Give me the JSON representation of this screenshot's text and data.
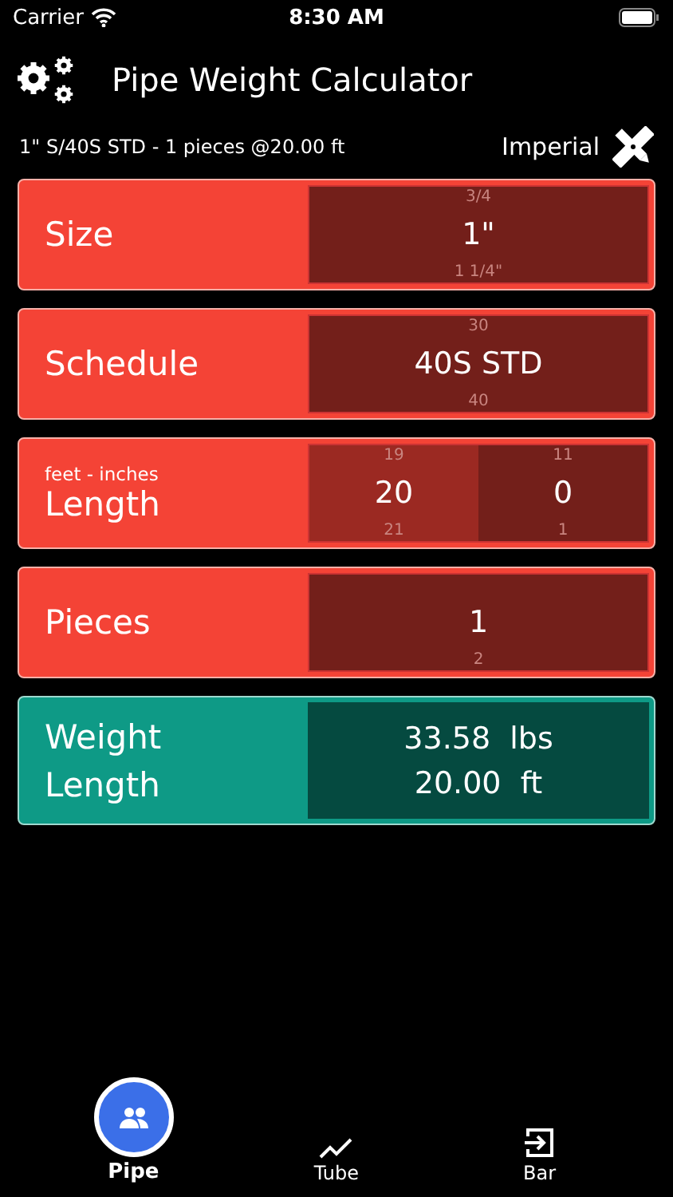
{
  "status_bar": {
    "carrier": "Carrier",
    "time": "8:30 AM"
  },
  "header": {
    "title": "Pipe Weight Calculator"
  },
  "summary": {
    "text": "1\" S/40S STD - 1 pieces @20.00 ft",
    "units": "Imperial"
  },
  "inputs": [
    {
      "kind": "single",
      "label": "Size",
      "columns": [
        {
          "above": "3/4",
          "value": "1\"",
          "below": "1 1/4\"",
          "selected": false
        }
      ]
    },
    {
      "kind": "single",
      "label": "Schedule",
      "columns": [
        {
          "above": "30",
          "value": "40S STD",
          "below": "40",
          "selected": false
        }
      ]
    },
    {
      "kind": "double",
      "caption": "feet - inches",
      "label": "Length",
      "columns": [
        {
          "above": "19",
          "value": "20",
          "below": "21",
          "selected": true
        },
        {
          "above": "11",
          "value": "0",
          "below": "1",
          "selected": false
        }
      ]
    },
    {
      "kind": "single",
      "label": "Pieces",
      "columns": [
        {
          "value": "1",
          "below": "2",
          "selected": false
        }
      ]
    }
  ],
  "result": {
    "rows": [
      {
        "label": "Weight",
        "value": "33.58",
        "unit": "lbs"
      },
      {
        "label": "Length",
        "value": "20.00",
        "unit": "ft"
      }
    ]
  },
  "tabs": [
    {
      "label": "Pipe",
      "kind": "people",
      "selected": true
    },
    {
      "label": "Tube",
      "kind": "trend",
      "selected": false
    },
    {
      "label": "Bar",
      "kind": "exit",
      "selected": false
    }
  ]
}
